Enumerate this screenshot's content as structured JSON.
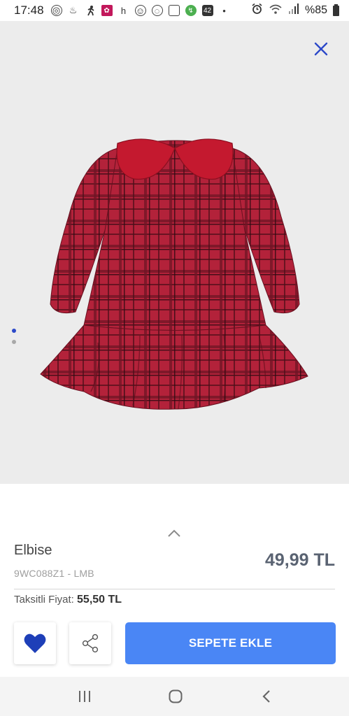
{
  "status_bar": {
    "time": "17:48",
    "left_icons": [
      "instagram-icon",
      "notification-icon",
      "runner-icon",
      "app-icon",
      "h-icon",
      "face-icon",
      "swirl-icon",
      "screenshot-icon",
      "green-app-icon",
      "42-icon"
    ],
    "left_icon_texts": [
      "◎",
      "♨",
      "🏃",
      "▣",
      "h",
      "☺",
      "◌",
      "▢",
      "↯",
      "42"
    ],
    "dot": "•",
    "battery_percent": "%85"
  },
  "image_area": {
    "pager_dots": 2,
    "active_dot": 0
  },
  "product": {
    "name": "Elbise",
    "code": "9WC088Z1 - LMB",
    "price": "49,99 TL",
    "installment_label": "Taksitli Fiyat:",
    "installment_price": "55,50 TL"
  },
  "actions": {
    "add_to_cart_label": "SEPETE EKLE"
  },
  "colors": {
    "accent_blue": "#4a86f5",
    "heart_blue": "#1e3fb8",
    "dress_red": "#b8223a"
  }
}
